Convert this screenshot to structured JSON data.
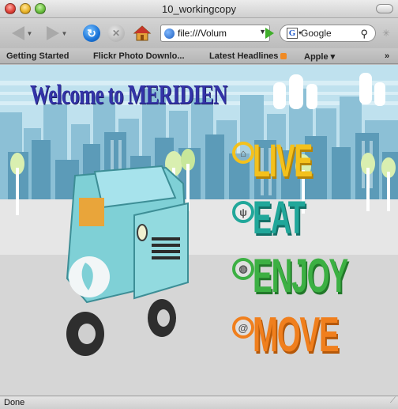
{
  "window": {
    "title": "10_workingcopy"
  },
  "toolbar": {
    "url": "file:///Volum",
    "search_engine": "Google",
    "icons": {
      "back": "back-arrow-icon",
      "forward": "forward-arrow-icon",
      "reload": "reload-icon",
      "stop": "stop-icon",
      "home": "home-icon",
      "go": "go-icon",
      "search": "search-icon"
    }
  },
  "bookmarks": [
    {
      "label": "Getting Started"
    },
    {
      "label": "Flickr Photo Downlo..."
    },
    {
      "label": "Latest Headlines"
    },
    {
      "label": "Apple ▾"
    },
    {
      "label": "»"
    }
  ],
  "page": {
    "welcome": "Welcome to MERIDIEN",
    "menu": [
      {
        "label": "LIVE",
        "color": "#f4c11c",
        "icon": "home-icon"
      },
      {
        "label": "EAT",
        "color": "#21a79a",
        "icon": "fork-icon"
      },
      {
        "label": "ENJOY",
        "color": "#3cb043",
        "icon": "bag-icon"
      },
      {
        "label": "MOVE",
        "color": "#f07f1d",
        "icon": "spiral-icon"
      }
    ]
  },
  "status": {
    "text": "Done"
  },
  "colors": {
    "sky": "#b6dbe9",
    "buildings": "#6aa7c2",
    "welcome_text": "#3333a8",
    "truck": "#7fd0d6"
  }
}
